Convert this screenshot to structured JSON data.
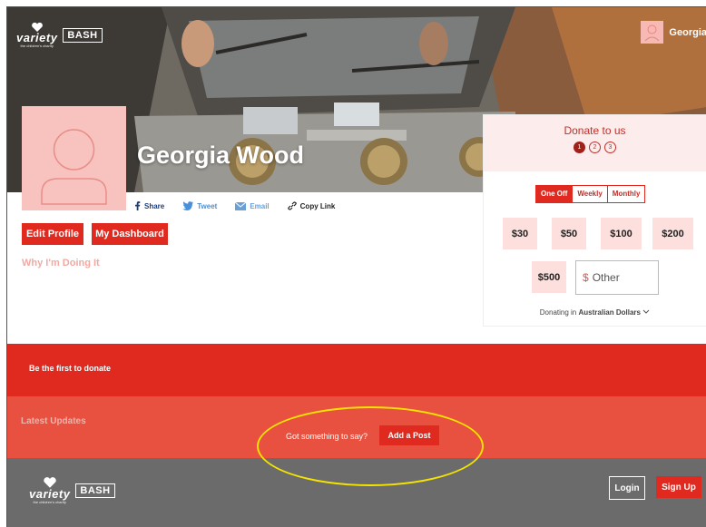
{
  "brand": {
    "logo_word": "variety",
    "logo_sub": "the children's charity",
    "bash_label": "BASH"
  },
  "nav": {
    "user_name": "Georgia"
  },
  "profile": {
    "name": "Georgia Wood",
    "share": {
      "share": "Share",
      "tweet": "Tweet",
      "email": "Email",
      "copy": "Copy Link"
    },
    "edit_label": "Edit Profile",
    "dashboard_label": "My Dashboard",
    "why_label": "Why I'm Doing It"
  },
  "donate": {
    "title": "Donate to us",
    "steps": [
      "1",
      "2",
      "3"
    ],
    "frequency": [
      "One Off",
      "Weekly",
      "Monthly"
    ],
    "amounts": [
      "$30",
      "$50",
      "$100",
      "$200",
      "$500"
    ],
    "other_currency": "$",
    "other_placeholder": "Other",
    "donating_prefix": "Donating in",
    "donating_currency": "Australian Dollars"
  },
  "feed": {
    "first_donate": "Be the first to donate",
    "latest_updates": "Latest Updates",
    "prompt": "Got something to say?",
    "add_post": "Add a Post"
  },
  "footer": {
    "login": "Login",
    "signup": "Sign Up"
  },
  "colors": {
    "brand_red": "#e02a1f",
    "band_coral": "#e8503f",
    "footer_gray": "#6b6b6b",
    "avatar_pink": "#f8c3bf",
    "annotation_yellow": "#f5e300"
  }
}
